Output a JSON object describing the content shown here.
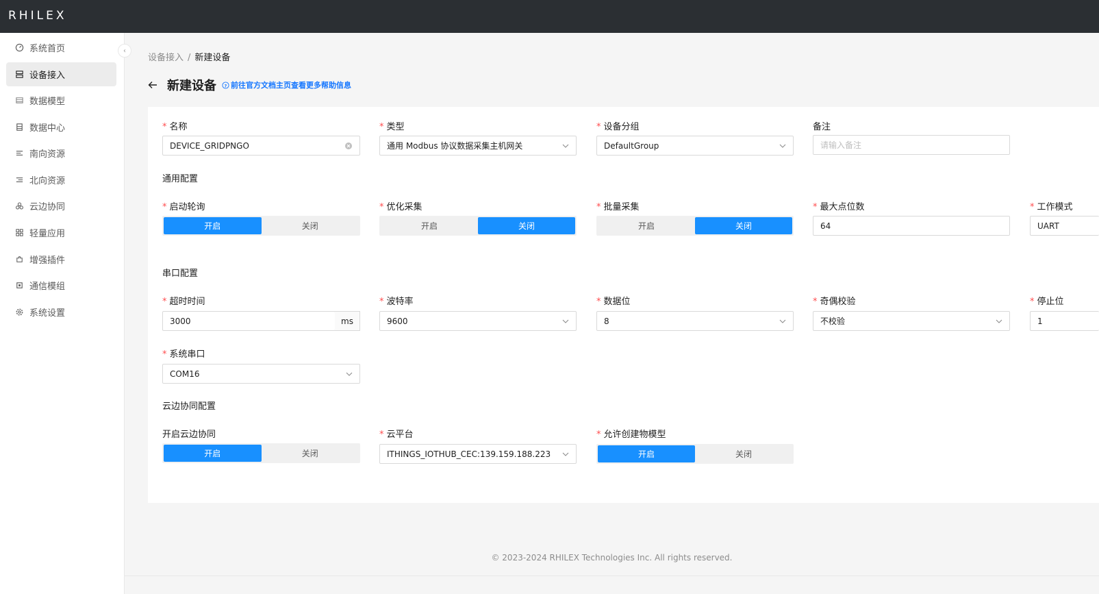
{
  "app": {
    "logo": "RHILEX"
  },
  "sidebar": {
    "items": [
      {
        "label": "系统首页",
        "icon": "dashboard-icon"
      },
      {
        "label": "设备接入",
        "icon": "device-icon",
        "active": true
      },
      {
        "label": "数据模型",
        "icon": "model-icon"
      },
      {
        "label": "数据中心",
        "icon": "database-icon"
      },
      {
        "label": "南向资源",
        "icon": "south-icon"
      },
      {
        "label": "北向资源",
        "icon": "north-icon"
      },
      {
        "label": "云边协同",
        "icon": "cloud-icon"
      },
      {
        "label": "轻量应用",
        "icon": "app-icon"
      },
      {
        "label": "增强插件",
        "icon": "plugin-icon"
      },
      {
        "label": "通信模组",
        "icon": "chip-icon"
      },
      {
        "label": "系统设置",
        "icon": "gear-icon"
      }
    ],
    "collapse": "‹"
  },
  "breadcrumb": {
    "parent": "设备接入",
    "separator": "/",
    "current": "新建设备"
  },
  "header": {
    "title": "新建设备",
    "help": "前往官方文档主页查看更多帮助信息"
  },
  "form": {
    "name": {
      "label": "名称",
      "value": "DEVICE_GRIDPNGO"
    },
    "type": {
      "label": "类型",
      "value": "通用 Modbus 协议数据采集主机网关"
    },
    "group": {
      "label": "设备分组",
      "value": "DefaultGroup"
    },
    "remark": {
      "label": "备注",
      "placeholder": "请输入备注"
    },
    "general_section": "通用配置",
    "polling": {
      "label": "启动轮询",
      "on": "开启",
      "off": "关闭",
      "selected": "on"
    },
    "optimize": {
      "label": "优化采集",
      "on": "开启",
      "off": "关闭",
      "selected": "off"
    },
    "batch": {
      "label": "批量采集",
      "on": "开启",
      "off": "关闭",
      "selected": "off"
    },
    "max_points": {
      "label": "最大点位数",
      "value": "64"
    },
    "work_mode": {
      "label": "工作模式",
      "value": "UART"
    },
    "serial_section": "串口配置",
    "timeout": {
      "label": "超时时间",
      "value": "3000",
      "unit": "ms"
    },
    "baud": {
      "label": "波特率",
      "value": "9600"
    },
    "data_bits": {
      "label": "数据位",
      "value": "8"
    },
    "parity": {
      "label": "奇偶校验",
      "value": "不校验"
    },
    "stop_bits": {
      "label": "停止位",
      "value": "1"
    },
    "port": {
      "label": "系统串口",
      "value": "COM16"
    },
    "cloud_section": "云边协同配置",
    "cloud_enable": {
      "label": "开启云边协同",
      "on": "开启",
      "off": "关闭",
      "selected": "on"
    },
    "platform": {
      "label": "云平台",
      "value": "ITHINGS_IOTHUB_CEC:139.159.188.223"
    },
    "allow_model": {
      "label": "允许创建物模型",
      "on": "开启",
      "off": "关闭",
      "selected": "on"
    }
  },
  "footer": {
    "text": "© 2023-2024 RHILEX Technologies Inc. All rights reserved."
  },
  "colors": {
    "primary": "#1890ff",
    "topbar": "#2b2f33",
    "required": "#ff4d4f"
  }
}
